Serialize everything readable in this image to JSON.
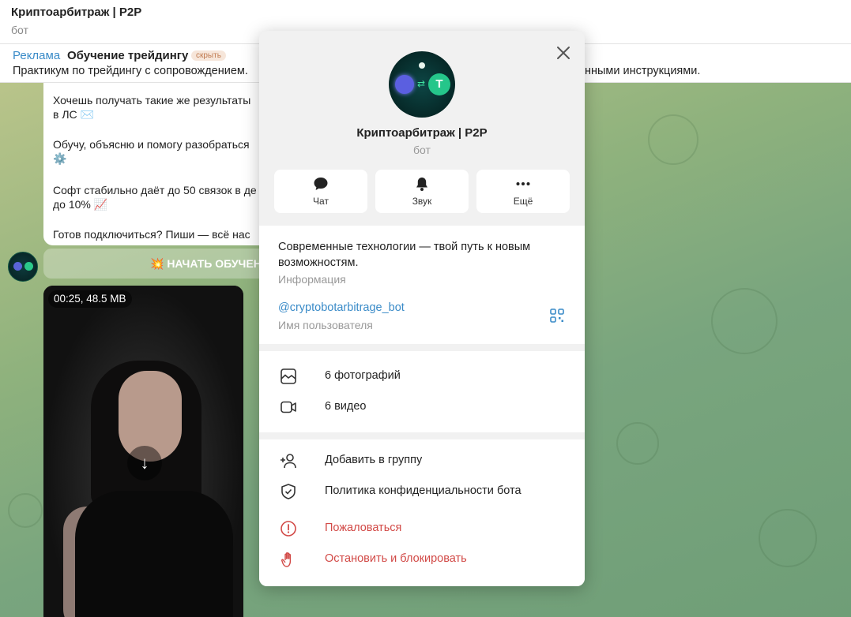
{
  "header": {
    "title": "Криптоарбитраж | P2P",
    "subtitle": "бот"
  },
  "ad": {
    "tag": "Реклама",
    "title": "Обучение трейдингу",
    "hide_label": "скрыть",
    "text": "Практикум по трейдингу с сопровождением.",
    "text_tail": "нными инструкциями."
  },
  "chat": {
    "message_lines": [
      "Хочешь получать такие же результаты",
      "в ЛС ✉️",
      "Обучу, объясню и помогу разобраться",
      "⚙️",
      "Софт стабильно даёт до 50 связок в де",
      "до 10% 📈",
      "Готов подключиться? Пиши — всё нас"
    ],
    "cta_label": "💥 НАЧАТЬ ОБУЧЕН",
    "video_badge": "00:25, 48.5 MB"
  },
  "profile": {
    "name": "Криптоарбитраж | P2P",
    "role": "бот",
    "actions": [
      {
        "label": "Чат",
        "icon": "chat-icon"
      },
      {
        "label": "Звук",
        "icon": "bell-icon"
      },
      {
        "label": "Ещё",
        "icon": "more-icon"
      }
    ],
    "about": "Современные технологии — твой путь к новым возможностям.",
    "about_caption": "Информация",
    "username": "@cryptobotarbitrage_bot",
    "username_caption": "Имя пользователя",
    "media": [
      {
        "label": "6 фотографий",
        "icon": "photo-icon"
      },
      {
        "label": "6 видео",
        "icon": "video-icon"
      }
    ],
    "menu": [
      {
        "label": "Добавить в группу",
        "icon": "add-user-icon"
      },
      {
        "label": "Политика конфиденциальности бота",
        "icon": "shield-icon"
      },
      {
        "label": "Пожаловаться",
        "icon": "report-icon"
      },
      {
        "label": "Остановить и блокировать",
        "icon": "hand-stop-icon"
      }
    ]
  },
  "colors": {
    "accent": "#3a8bc8",
    "danger": "#d24a47"
  }
}
